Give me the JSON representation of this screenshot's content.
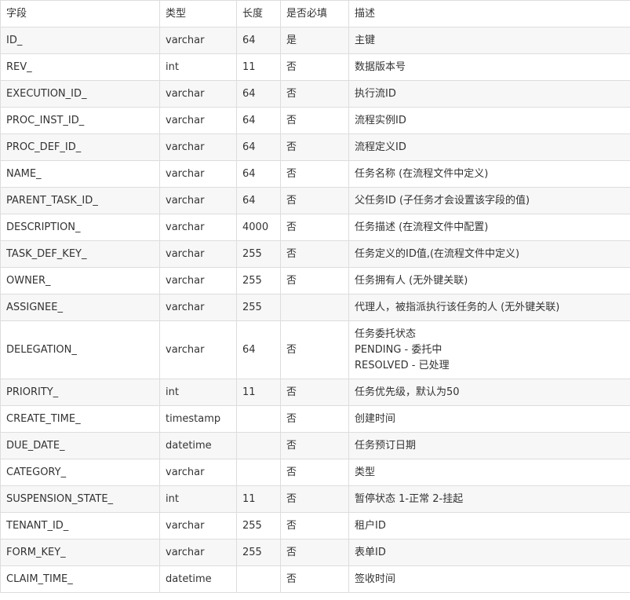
{
  "table": {
    "headers": [
      "字段",
      "类型",
      "长度",
      "是否必填",
      "描述"
    ],
    "rows": [
      {
        "field": "ID_",
        "type": "varchar",
        "length": "64",
        "required": "是",
        "desc": [
          "主键"
        ]
      },
      {
        "field": "REV_",
        "type": "int",
        "length": "11",
        "required": "否",
        "desc": [
          "数据版本号"
        ]
      },
      {
        "field": "EXECUTION_ID_",
        "type": "varchar",
        "length": "64",
        "required": "否",
        "desc": [
          "执行流ID"
        ]
      },
      {
        "field": "PROC_INST_ID_",
        "type": "varchar",
        "length": "64",
        "required": "否",
        "desc": [
          "流程实例ID"
        ]
      },
      {
        "field": "PROC_DEF_ID_",
        "type": "varchar",
        "length": "64",
        "required": "否",
        "desc": [
          "流程定义ID"
        ]
      },
      {
        "field": "NAME_",
        "type": "varchar",
        "length": "64",
        "required": "否",
        "desc": [
          "任务名称 (在流程文件中定义)"
        ]
      },
      {
        "field": "PARENT_TASK_ID_",
        "type": "varchar",
        "length": "64",
        "required": "否",
        "desc": [
          "父任务ID (子任务才会设置该字段的值)"
        ]
      },
      {
        "field": "DESCRIPTION_",
        "type": "varchar",
        "length": "4000",
        "required": "否",
        "desc": [
          "任务描述 (在流程文件中配置)"
        ]
      },
      {
        "field": "TASK_DEF_KEY_",
        "type": "varchar",
        "length": "255",
        "required": "否",
        "desc": [
          "任务定义的ID值,(在流程文件中定义)"
        ]
      },
      {
        "field": "OWNER_",
        "type": "varchar",
        "length": "255",
        "required": "否",
        "desc": [
          "任务拥有人 (无外键关联)"
        ]
      },
      {
        "field": "ASSIGNEE_",
        "type": "varchar",
        "length": "255",
        "required": "",
        "desc": [
          "代理人，被指派执行该任务的人 (无外键关联)"
        ]
      },
      {
        "field": "DELEGATION_",
        "type": "varchar",
        "length": "64",
        "required": "否",
        "desc": [
          "任务委托状态",
          "PENDING - 委托中",
          "RESOLVED - 已处理"
        ]
      },
      {
        "field": "PRIORITY_",
        "type": "int",
        "length": "11",
        "required": "否",
        "desc": [
          "任务优先级，默认为50"
        ]
      },
      {
        "field": "CREATE_TIME_",
        "type": "timestamp",
        "length": "",
        "required": "否",
        "desc": [
          "创建时间"
        ]
      },
      {
        "field": "DUE_DATE_",
        "type": "datetime",
        "length": "",
        "required": "否",
        "desc": [
          "任务预订日期"
        ]
      },
      {
        "field": "CATEGORY_",
        "type": "varchar",
        "length": "",
        "required": "否",
        "desc": [
          "类型"
        ]
      },
      {
        "field": "SUSPENSION_STATE_",
        "type": "int",
        "length": "11",
        "required": "否",
        "desc": [
          "暂停状态 1-正常 2-挂起"
        ]
      },
      {
        "field": "TENANT_ID_",
        "type": "varchar",
        "length": "255",
        "required": "否",
        "desc": [
          "租户ID"
        ]
      },
      {
        "field": "FORM_KEY_",
        "type": "varchar",
        "length": "255",
        "required": "否",
        "desc": [
          "表单ID"
        ]
      },
      {
        "field": "CLAIM_TIME_",
        "type": "datetime",
        "length": "",
        "required": "否",
        "desc": [
          "签收时间"
        ]
      }
    ]
  }
}
